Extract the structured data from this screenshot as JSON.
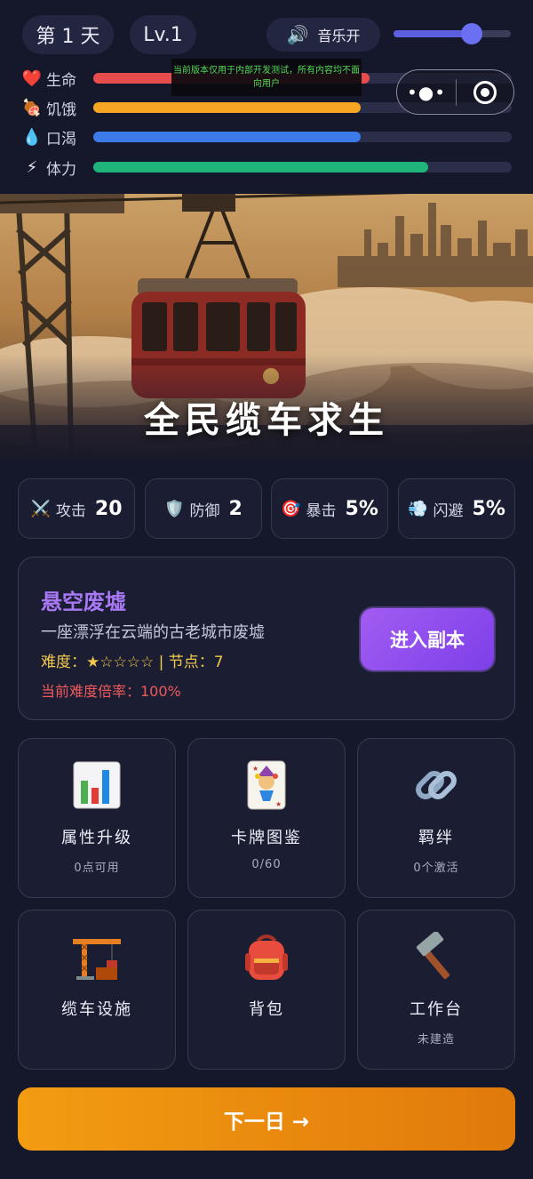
{
  "hud": {
    "day_label": "第 1 天",
    "level_label": "Lv.1",
    "music": {
      "icon": "speaker-icon",
      "label": "音乐开",
      "volume": 0.67
    },
    "stats": [
      {
        "key": "hp",
        "icon": "heart-icon",
        "label": "生命",
        "value": 0.66,
        "color": "#e84c4c"
      },
      {
        "key": "hunger",
        "icon": "meat-icon",
        "label": "饥饿",
        "value": 0.64,
        "color": "#f5a623"
      },
      {
        "key": "thirst",
        "icon": "water-drop-icon",
        "label": "口渴",
        "value": 0.64,
        "color": "#3b7ae8"
      },
      {
        "key": "stamina",
        "icon": "lightning-icon",
        "label": "体力",
        "value": 0.8,
        "color": "#1fb57a"
      }
    ],
    "dev_note": "当前版本仅用于内部开发测试，所有内容均不面向用户"
  },
  "banner": {
    "title": "全民缆车求生"
  },
  "combat": [
    {
      "icon": "swords-icon",
      "label": "攻击",
      "value": "20"
    },
    {
      "icon": "shield-icon",
      "label": "防御",
      "value": "2"
    },
    {
      "icon": "target-icon",
      "label": "暴击",
      "value": "5%"
    },
    {
      "icon": "wind-icon",
      "label": "闪避",
      "value": "5%"
    }
  ],
  "dungeon": {
    "title": "悬空废墟",
    "description": "一座漂浮在云端的古老城市废墟",
    "meta": "难度：★☆☆☆☆ | 节点：7",
    "rate": "当前难度倍率：100%",
    "enter_label": "进入副本"
  },
  "menu": [
    {
      "icon": "bar-chart-icon",
      "label": "属性升级",
      "sub": "0点可用"
    },
    {
      "icon": "joker-card-icon",
      "label": "卡牌图鉴",
      "sub": "0/60"
    },
    {
      "icon": "link-icon",
      "label": "羁绊",
      "sub": "0个激活"
    },
    {
      "icon": "crane-icon",
      "label": "缆车设施",
      "sub": ""
    },
    {
      "icon": "backpack-icon",
      "label": "背包",
      "sub": ""
    },
    {
      "icon": "hammer-icon",
      "label": "工作台",
      "sub": "未建造"
    }
  ],
  "next_day_label": "下一日 →"
}
